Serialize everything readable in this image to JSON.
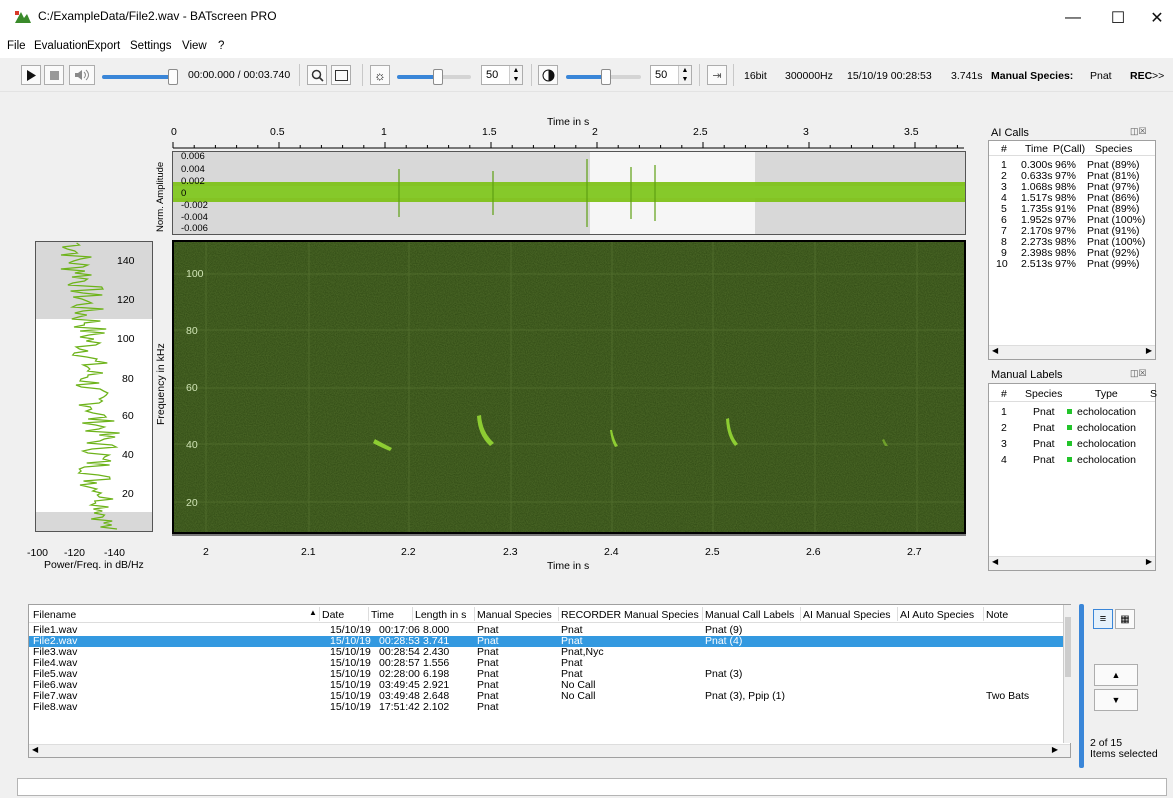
{
  "window": {
    "title": "C:/ExampleData/File2.wav - BATscreen PRO"
  },
  "menu": [
    "File",
    "Evaluation",
    "Export",
    "Settings",
    "View",
    "?"
  ],
  "toolbar": {
    "time_display": "00:00.000 / 00:03.740",
    "brightness_value": "50",
    "contrast_value": "50",
    "bit_depth": "16bit",
    "sample_rate": "300000Hz",
    "datetime": "15/10/19 00:28:53",
    "duration": "3.741s",
    "manual_species_label": "Manual Species:",
    "manual_species_value": "Pnat",
    "rec_label": "REC",
    "more": ">>"
  },
  "waveform": {
    "top_axis_title": "Time in s",
    "top_ticks": [
      "0",
      "0.5",
      "1",
      "1.5",
      "2",
      "2.5",
      "3",
      "3.5"
    ],
    "y_label": "Norm. Amplitude",
    "y_ticks": [
      "0.006",
      "0.004",
      "0.002",
      "0",
      "-0.002",
      "-0.004",
      "-0.006"
    ]
  },
  "spectrogram": {
    "y_label": "Frequency in kHz",
    "y_ticks": [
      "100",
      "80",
      "60",
      "40",
      "20"
    ],
    "x_ticks": [
      "2",
      "2.1",
      "2.2",
      "2.3",
      "2.4",
      "2.5",
      "2.6",
      "2.7"
    ],
    "x_label": "Time in s"
  },
  "power_spectrum": {
    "y_ticks": [
      "140",
      "120",
      "100",
      "80",
      "60",
      "40",
      "20"
    ],
    "x_ticks": [
      "-100",
      "-120",
      "-140"
    ],
    "x_label": "Power/Freq. in dB/Hz"
  },
  "ai_calls": {
    "title": "AI Calls",
    "headers": [
      "#",
      "Time",
      "P(Call)",
      "Species"
    ],
    "rows": [
      [
        "1",
        "0.300s",
        "96%",
        "Pnat (89%)"
      ],
      [
        "2",
        "0.633s",
        "97%",
        "Pnat (81%)"
      ],
      [
        "3",
        "1.068s",
        "98%",
        "Pnat (97%)"
      ],
      [
        "4",
        "1.517s",
        "98%",
        "Pnat (86%)"
      ],
      [
        "5",
        "1.735s",
        "91%",
        "Pnat (89%)"
      ],
      [
        "6",
        "1.952s",
        "97%",
        "Pnat (100%)"
      ],
      [
        "7",
        "2.170s",
        "97%",
        "Pnat (91%)"
      ],
      [
        "8",
        "2.273s",
        "98%",
        "Pnat (100%)"
      ],
      [
        "9",
        "2.398s",
        "98%",
        "Pnat (92%)"
      ],
      [
        "10",
        "2.513s",
        "97%",
        "Pnat (99%)"
      ]
    ]
  },
  "manual_labels": {
    "title": "Manual Labels",
    "headers": [
      "#",
      "Species",
      "Type",
      "S"
    ],
    "rows": [
      [
        "1",
        "Pnat",
        "echolocation"
      ],
      [
        "2",
        "Pnat",
        "echolocation"
      ],
      [
        "3",
        "Pnat",
        "echolocation"
      ],
      [
        "4",
        "Pnat",
        "echolocation"
      ]
    ]
  },
  "file_list": {
    "headers": [
      "Filename",
      "Date",
      "Time",
      "Length in s",
      "Manual Species",
      "RECORDER Manual Species",
      "Manual Call Labels",
      "AI Manual Species",
      "AI Auto Species",
      "Note"
    ],
    "rows": [
      [
        "File1.wav",
        "15/10/19",
        "00:17:06",
        "8.000",
        "Pnat",
        "Pnat",
        "Pnat (9)",
        "",
        "",
        ""
      ],
      [
        "File2.wav",
        "15/10/19",
        "00:28:53",
        "3.741",
        "Pnat",
        "Pnat",
        "Pnat (4)",
        "",
        "",
        ""
      ],
      [
        "File3.wav",
        "15/10/19",
        "00:28:54",
        "2.430",
        "Pnat",
        "Pnat,Nyc",
        "",
        "",
        "",
        ""
      ],
      [
        "File4.wav",
        "15/10/19",
        "00:28:57",
        "1.556",
        "Pnat",
        "Pnat",
        "",
        "",
        "",
        ""
      ],
      [
        "File5.wav",
        "15/10/19",
        "02:28:00",
        "6.198",
        "Pnat",
        "Pnat",
        "Pnat (3)",
        "",
        "",
        ""
      ],
      [
        "File6.wav",
        "15/10/19",
        "03:49:45",
        "2.921",
        "Pnat",
        "No Call",
        "",
        "",
        "",
        ""
      ],
      [
        "File7.wav",
        "15/10/19",
        "03:49:48",
        "2.648",
        "Pnat",
        "No Call",
        "Pnat (3), Ppip (1)",
        "",
        "",
        "Two Bats"
      ],
      [
        "File8.wav",
        "15/10/19",
        "17:51:42",
        "2.102",
        "Pnat",
        "",
        "",
        "",
        "",
        ""
      ]
    ],
    "selection_count": "2 of 15",
    "selection_label": "Items selected"
  },
  "colors": {
    "selection": "#3399e0",
    "accent": "#3a86d8",
    "spectrogram_bg": "#2e4a14",
    "signal": "#7fc21a"
  }
}
